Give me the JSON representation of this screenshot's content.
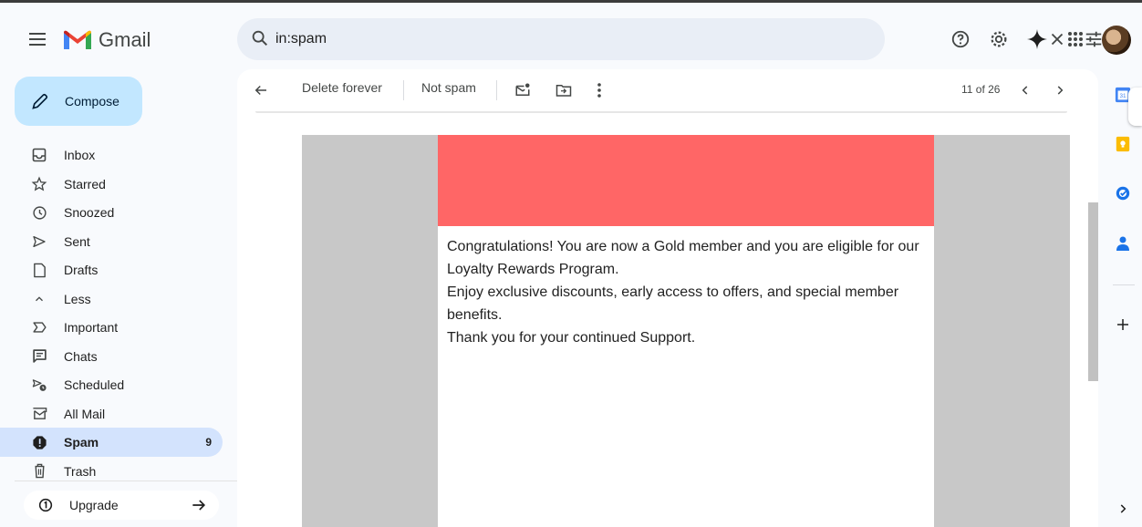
{
  "app": {
    "name": "Gmail"
  },
  "search": {
    "value": "in:spam"
  },
  "compose": {
    "label": "Compose"
  },
  "nav": {
    "items": [
      {
        "label": "Inbox",
        "icon": "inbox-icon",
        "count": ""
      },
      {
        "label": "Starred",
        "icon": "star-icon",
        "count": ""
      },
      {
        "label": "Snoozed",
        "icon": "clock-icon",
        "count": ""
      },
      {
        "label": "Sent",
        "icon": "send-icon",
        "count": ""
      },
      {
        "label": "Drafts",
        "icon": "draft-icon",
        "count": ""
      },
      {
        "label": "Less",
        "icon": "chevron-up-icon",
        "count": ""
      },
      {
        "label": "Important",
        "icon": "important-icon",
        "count": ""
      },
      {
        "label": "Chats",
        "icon": "chat-icon",
        "count": ""
      },
      {
        "label": "Scheduled",
        "icon": "scheduled-send-icon",
        "count": ""
      },
      {
        "label": "All Mail",
        "icon": "all-mail-icon",
        "count": ""
      },
      {
        "label": "Spam",
        "icon": "spam-icon",
        "count": "9"
      },
      {
        "label": "Trash",
        "icon": "trash-icon",
        "count": ""
      }
    ],
    "upgrade": "Upgrade"
  },
  "toolbar": {
    "delete_forever": "Delete forever",
    "not_spam": "Not spam",
    "pager": "11 of 26"
  },
  "email": {
    "banner_color": "#ff6666",
    "paragraphs": [
      "Congratulations! You are now a Gold member and you are eligible for our Loyalty Rewards Program.",
      "Enjoy exclusive discounts, early access to offers, and special member benefits.",
      "Thank you for your continued Support."
    ]
  },
  "colors": {
    "accent": "#c2e7ff",
    "active_nav": "#d3e3fd",
    "search_bg": "#e9eef6"
  }
}
